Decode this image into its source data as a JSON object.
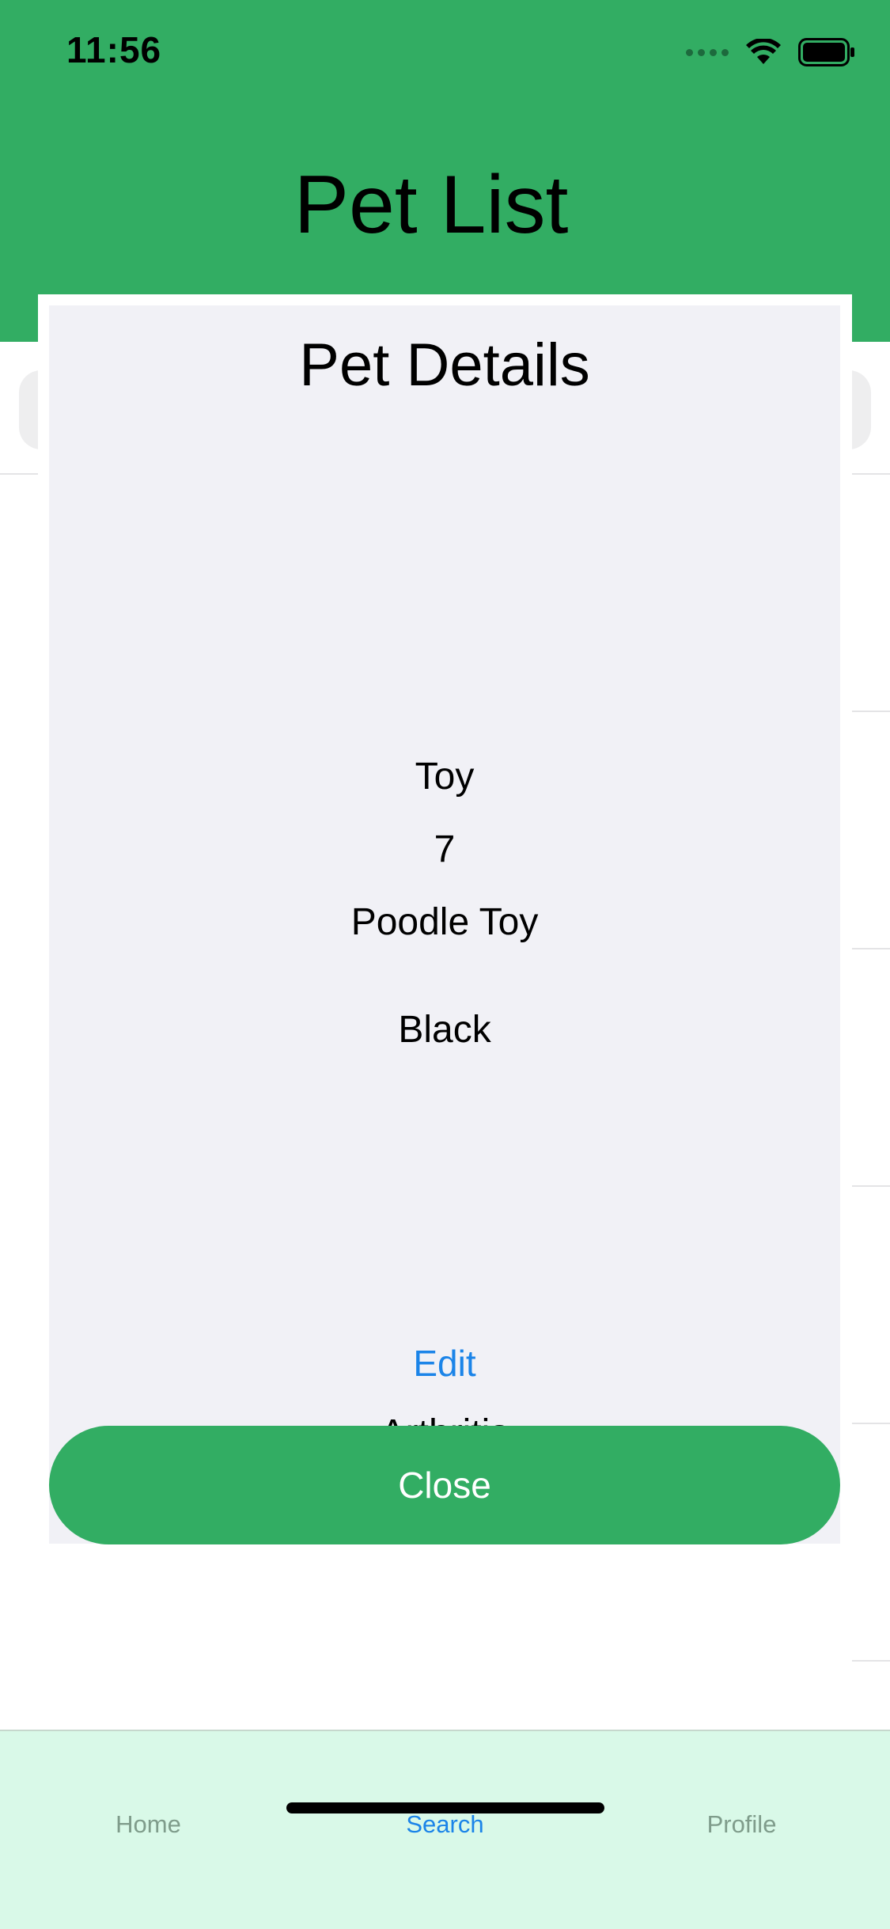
{
  "status_bar": {
    "time": "11:56"
  },
  "header": {
    "title": "Pet List"
  },
  "modal": {
    "title": "Pet Details",
    "size": "Toy",
    "age": "7",
    "breed": "Poodle Toy",
    "color": "Black",
    "condition": "Arthritis",
    "edit_label": "Edit",
    "close_label": "Close"
  },
  "tabs": [
    {
      "label": "Home",
      "active": false
    },
    {
      "label": "Search",
      "active": true
    },
    {
      "label": "Profile",
      "active": false
    }
  ],
  "colors": {
    "header": "#32ad63",
    "modal_bg": "#f1f1f6",
    "accent": "#1b84e8",
    "tabbar": "#d9f9e8"
  }
}
